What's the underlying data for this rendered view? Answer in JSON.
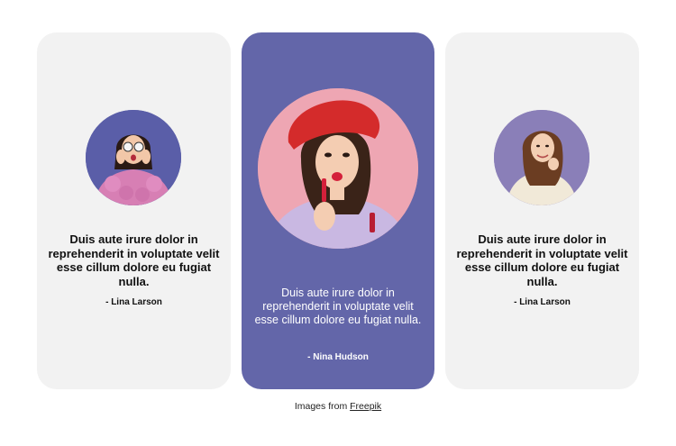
{
  "cards": [
    {
      "quote": "Duis aute irure dolor in reprehenderit in voluptate velit esse cillum dolore eu fugiat nulla.",
      "author": "- Lina Larson"
    },
    {
      "quote": "Duis aute irure dolor in reprehenderit in voluptate velit esse cillum dolore eu fugiat nulla.",
      "author": "- Nina Hudson"
    },
    {
      "quote": "Duis aute irure dolor in reprehenderit in voluptate velit esse cillum dolore eu fugiat nulla.",
      "author": "- Lina Larson"
    }
  ],
  "footer": {
    "prefix": "Images from",
    "link": "Freepik"
  },
  "colors": {
    "card_light": "#f2f2f2",
    "card_accent": "#6366a9",
    "avatar_pink": "#eea6b3"
  }
}
